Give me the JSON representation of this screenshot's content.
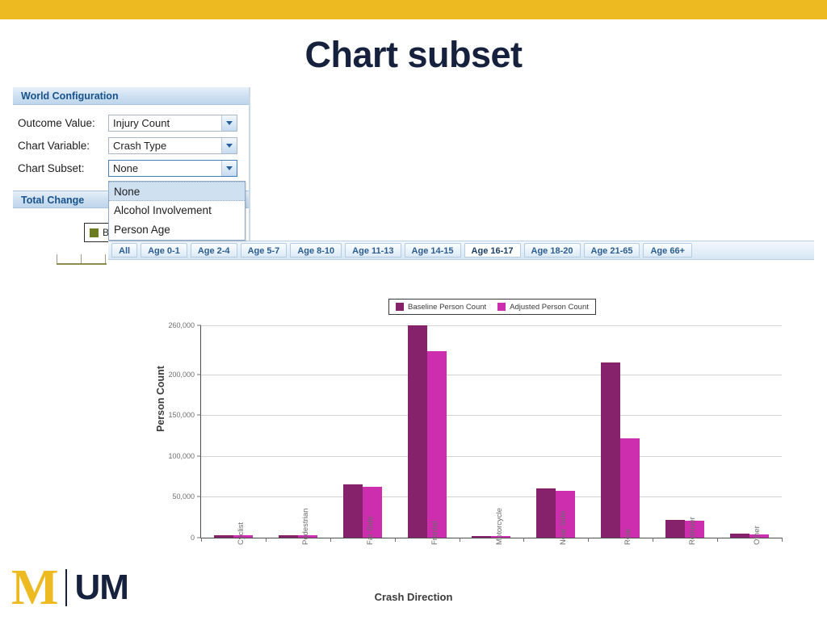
{
  "slide": {
    "title": "Chart subset",
    "accent_gold": "#EDBA21",
    "title_color": "#16213E"
  },
  "app_panel": {
    "header": "World Configuration",
    "fields": [
      {
        "label": "Outcome Value:",
        "value": "Injury Count",
        "icon": "chevron-down-icon"
      },
      {
        "label": "Chart Variable:",
        "value": "Crash Type",
        "icon": "chevron-down-icon"
      },
      {
        "label": "Chart Subset:",
        "value": "None",
        "icon": "chevron-down-icon"
      }
    ],
    "total_change_header": "Total Change",
    "mini_legend": {
      "label": "Ba",
      "swatch_color": "#6B7B1F"
    }
  },
  "dropdown": {
    "open": true,
    "options": [
      "None",
      "Alcohol Involvement",
      "Person Age"
    ],
    "selected": "None",
    "highlight_color": "#cfe0f1"
  },
  "tab_strip": {
    "tabs": [
      "All",
      "Age 0-1",
      "Age 2-4",
      "Age 5-7",
      "Age 8-10",
      "Age 11-13",
      "Age 14-15",
      "Age 16-17",
      "Age 18-20",
      "Age 21-65",
      "Age 66+"
    ],
    "active": "Age 16-17"
  },
  "um_logo": {
    "mark": "M",
    "wordmark": "UM"
  },
  "chart_data": {
    "type": "bar",
    "title": "",
    "xlabel": "Crash Direction",
    "ylabel": "Person Count",
    "ylim": [
      0,
      260000
    ],
    "yticks": [
      0,
      50000,
      100000,
      150000,
      200000,
      260000
    ],
    "ytick_labels": [
      "0",
      "50,000",
      "100,000",
      "150,000",
      "200,000",
      "260,000"
    ],
    "grid": true,
    "legend_position": "top-center",
    "categories": [
      "Cyclist",
      "Pedestrian",
      "Far Side",
      "Frontal",
      "Motorcycle",
      "Near Side",
      "Rear",
      "Rollover",
      "Other"
    ],
    "series": [
      {
        "name": "Baseline Person Count",
        "color": "#86216B",
        "values": [
          3000,
          2800,
          65000,
          260000,
          1800,
          60000,
          215000,
          22000,
          5000
        ]
      },
      {
        "name": "Adjusted Person Count",
        "color": "#CC2EAD",
        "values": [
          2800,
          2600,
          62000,
          228000,
          1700,
          57000,
          122000,
          21000,
          4200
        ]
      }
    ]
  }
}
